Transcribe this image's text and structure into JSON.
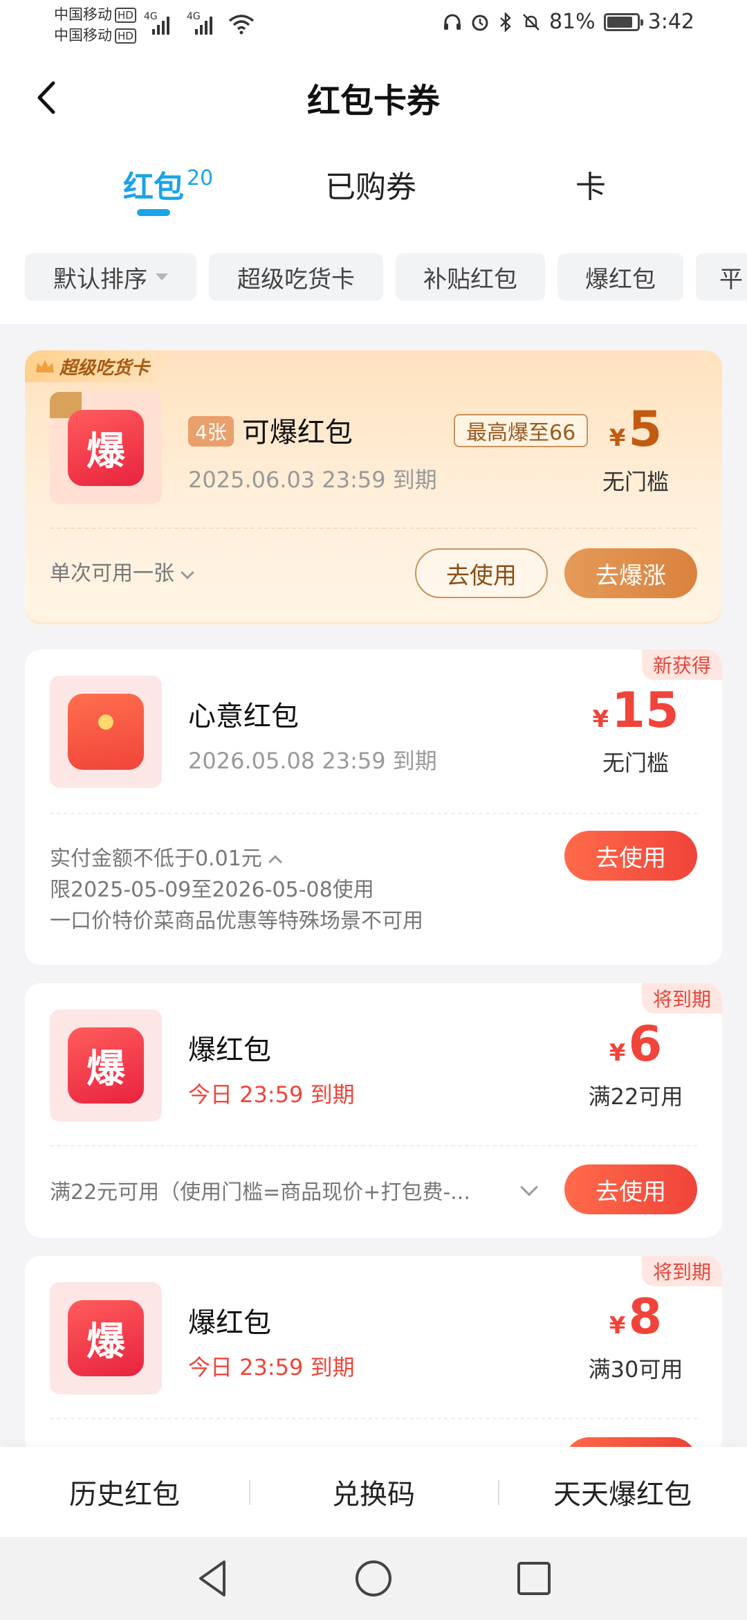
{
  "status_bar": {
    "carrier1": "中国移动",
    "carrier2": "中国移动",
    "hd": "HD",
    "net1": "4G",
    "net2": "4G",
    "battery_pct": "81%",
    "battery_level": 0.81,
    "time": "3:42"
  },
  "header": {
    "title": "红包卡券"
  },
  "tabs": [
    {
      "label": "红包",
      "count": "20",
      "active": true
    },
    {
      "label": "已购券"
    },
    {
      "label": "卡"
    }
  ],
  "filters": [
    "默认排序",
    "超级吃货卡",
    "补贴红包",
    "爆红包",
    "平"
  ],
  "cards": [
    {
      "ribbon": "超级吃货卡",
      "thumb_text": "爆",
      "count_tag": "4张",
      "title": "可爆红包",
      "boost_tag": "最高爆至66",
      "expiry": "2025.06.03 23:59 到期",
      "currency": "¥",
      "amount": "5",
      "condition": "无门槛",
      "note": "单次可用一张",
      "btn_use": "去使用",
      "btn_boost": "去爆涨"
    },
    {
      "corner_tag": "新获得",
      "title": "心意红包",
      "expiry": "2026.05.08 23:59 到期",
      "currency": "¥",
      "amount": "15",
      "condition": "无门槛",
      "notes": [
        "实付金额不低于0.01元",
        "限2025-05-09至2026-05-08使用",
        "一口价特价菜商品优惠等特殊场景不可用"
      ],
      "btn_use": "去使用"
    },
    {
      "corner_tag": "将到期",
      "thumb_text": "爆",
      "title": "爆红包",
      "expiry": "今日 23:59 到期",
      "currency": "¥",
      "amount": "6",
      "condition": "满22可用",
      "note": "满22元可用（使用门槛=商品现价+打包费-...",
      "btn_use": "去使用"
    },
    {
      "corner_tag": "将到期",
      "thumb_text": "爆",
      "title": "爆红包",
      "expiry": "今日 23:59 到期",
      "currency": "¥",
      "amount": "8",
      "condition": "满30可用"
    }
  ],
  "bottom_bar": [
    "历史红包",
    "兑换码",
    "天天爆红包"
  ],
  "colors": {
    "accent": "#1aa3e8",
    "red": "#f0443a",
    "gold": "#c25a12"
  }
}
